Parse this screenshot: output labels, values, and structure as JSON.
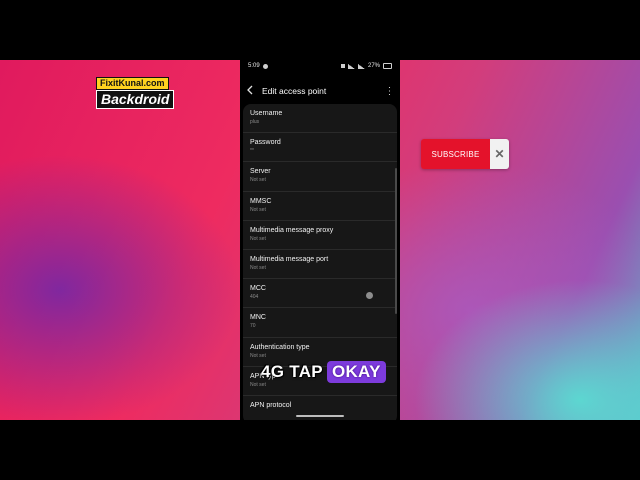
{
  "branding": {
    "site": "FixitKunal.com",
    "name": "Backdroid"
  },
  "subscribe": {
    "label": "SUBSCRIBE",
    "close": "✕"
  },
  "status_bar": {
    "time": "5:09",
    "battery": "27%"
  },
  "app_bar": {
    "back_icon": "back-arrow-icon",
    "title": "Edit access point",
    "more_icon": "⋮"
  },
  "fields": [
    {
      "label": "Username",
      "value": "plus"
    },
    {
      "label": "Password",
      "value": "**"
    },
    {
      "label": "Server",
      "value": "Not set"
    },
    {
      "label": "MMSC",
      "value": "Not set"
    },
    {
      "label": "Multimedia message proxy",
      "value": "Not set"
    },
    {
      "label": "Multimedia message port",
      "value": "Not set"
    },
    {
      "label": "MCC",
      "value": "404"
    },
    {
      "label": "MNC",
      "value": "70"
    },
    {
      "label": "Authentication type",
      "value": "Not set"
    },
    {
      "label": "APN type",
      "value": "Not set"
    },
    {
      "label": "APN protocol",
      "value": ""
    }
  ],
  "overlay": {
    "text_1": "4G TAP",
    "text_2": "OKAY"
  },
  "colors": {
    "subscribe_red": "#e4122b",
    "overlay_purple": "#7d3bdc",
    "card_bg": "#171717"
  }
}
